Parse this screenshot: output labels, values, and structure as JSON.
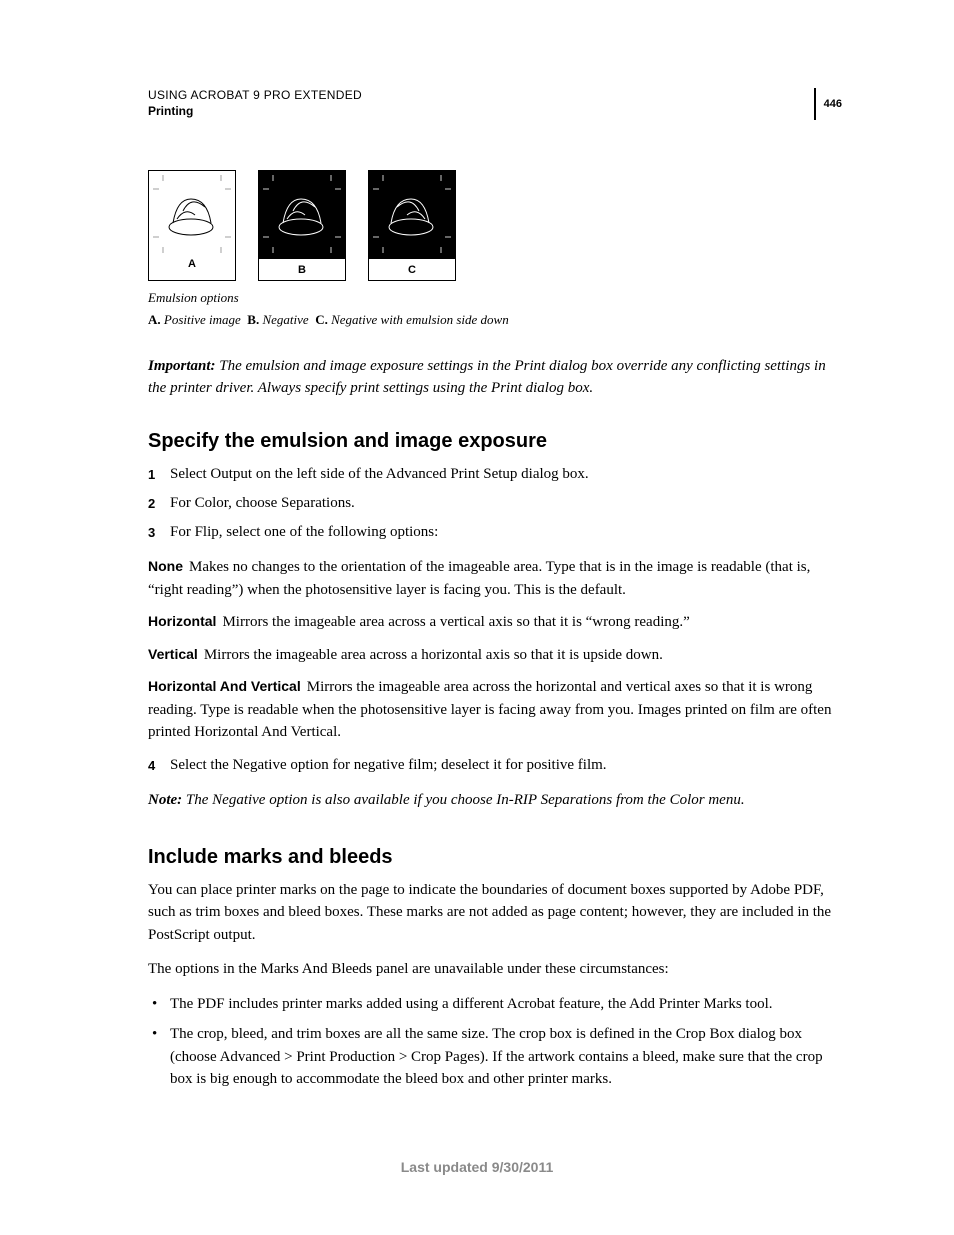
{
  "header": {
    "doc_title": "USING ACROBAT 9 PRO EXTENDED",
    "section": "Printing",
    "page_number": "446"
  },
  "figure": {
    "labels": {
      "a": "A",
      "b": "B",
      "c": "C"
    },
    "caption_title": "Emulsion options",
    "options": [
      {
        "label": "A.",
        "text": "Positive image"
      },
      {
        "label": "B.",
        "text": "Negative"
      },
      {
        "label": "C.",
        "text": "Negative with emulsion side down"
      }
    ]
  },
  "important": {
    "lead": "Important:",
    "body": "The emulsion and image exposure settings in the Print dialog box override any conflicting settings in the printer driver. Always specify print settings using the Print dialog box."
  },
  "section1": {
    "title": "Specify the emulsion and image exposure",
    "steps": [
      "Select Output on the left side of the Advanced Print Setup dialog box.",
      "For Color, choose Separations.",
      "For Flip, select one of the following options:"
    ],
    "defterms": [
      {
        "term": "None",
        "body": "Makes no changes to the orientation of the imageable area. Type that is in the image is readable (that is, “right reading”) when the photosensitive layer is facing you. This is the default."
      },
      {
        "term": "Horizontal",
        "body": "Mirrors the imageable area across a vertical axis so that it is “wrong reading.”"
      },
      {
        "term": "Vertical",
        "body": "Mirrors the imageable area across a horizontal axis so that it is upside down."
      },
      {
        "term": "Horizontal And Vertical",
        "body": "Mirrors the imageable area across the horizontal and vertical axes so that it is wrong reading. Type is readable when the photosensitive layer is facing away from you. Images printed on film are often printed Horizontal And Vertical."
      }
    ],
    "step4_num": "4",
    "step4": "Select the Negative option for negative film; deselect it for positive film.",
    "note_lead": "Note:",
    "note_body": "The Negative option is also available if you choose In-RIP Separations from the Color menu."
  },
  "section2": {
    "title": "Include marks and bleeds",
    "p1": "You can place printer marks on the page to indicate the boundaries of document boxes supported by Adobe PDF, such as trim boxes and bleed boxes. These marks are not added as page content; however, they are included in the PostScript output.",
    "p2": "The options in the Marks And Bleeds panel are unavailable under these circumstances:",
    "bullets": [
      "The PDF includes printer marks added using a different Acrobat feature, the Add Printer Marks tool.",
      "The crop, bleed, and trim boxes are all the same size. The crop box is defined in the Crop Box dialog box (choose Advanced > Print Production > Crop Pages). If the artwork contains a bleed, make sure that the crop box is big enough to accommodate the bleed box and other printer marks."
    ]
  },
  "footer": {
    "text": "Last updated 9/30/2011"
  }
}
